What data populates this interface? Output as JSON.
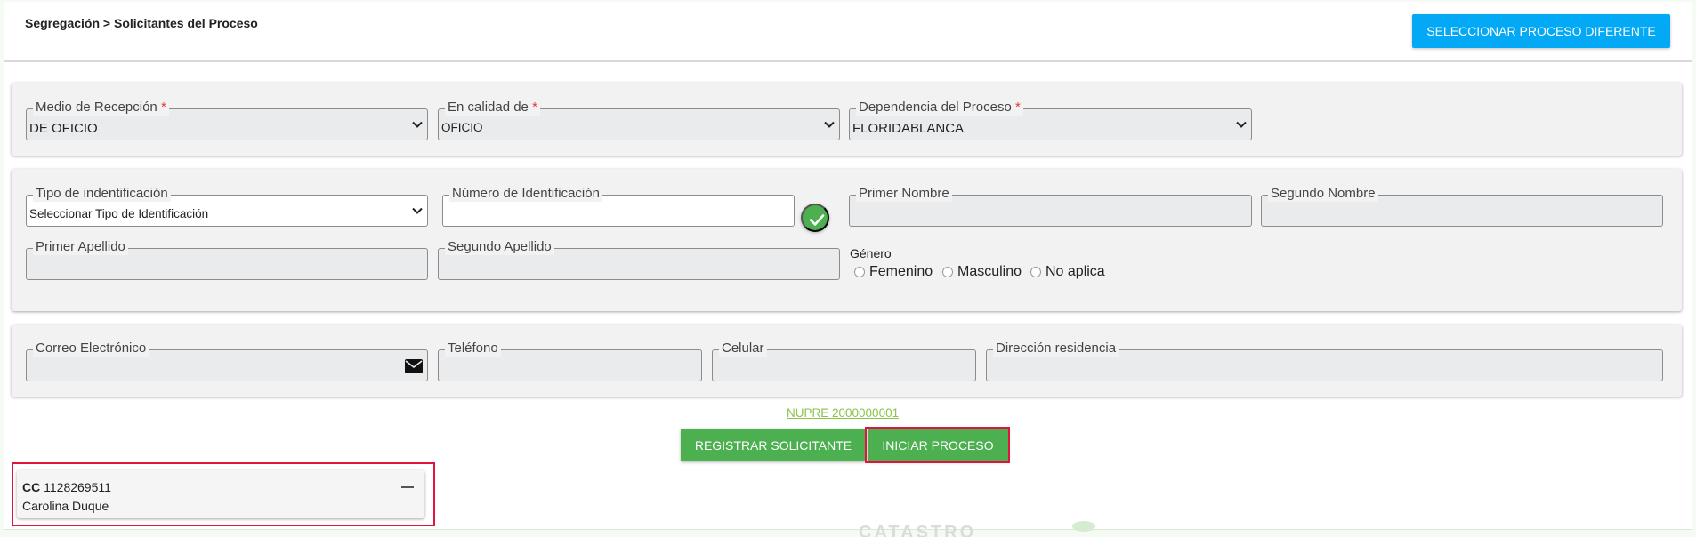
{
  "header": {
    "breadcrumb": "Segregación > Solicitantes del Proceso",
    "select_process_button": "SELECCIONAR PROCESO DIFERENTE"
  },
  "reception": {
    "medio": {
      "label": "Medio de Recepción",
      "value": "DE OFICIO"
    },
    "calidad": {
      "label": "En calidad de",
      "value": "OFICIO"
    },
    "dependencia": {
      "label": "Dependencia del Proceso",
      "value": "FLORIDABLANCA"
    }
  },
  "identity": {
    "tipo_id": {
      "label": "Tipo de indentificación",
      "value": "Seleccionar Tipo de Identificación"
    },
    "numero_id": {
      "label": "Número de Identificación",
      "value": ""
    },
    "primer_nombre": {
      "label": "Primer Nombre",
      "value": ""
    },
    "segundo_nombre": {
      "label": "Segundo Nombre",
      "value": ""
    },
    "primer_apellido": {
      "label": "Primer Apellido",
      "value": ""
    },
    "segundo_apellido": {
      "label": "Segundo Apellido",
      "value": ""
    },
    "genero": {
      "label": "Género",
      "options": [
        "Femenino",
        "Masculino",
        "No aplica"
      ]
    }
  },
  "contact": {
    "correo": {
      "label": "Correo Electrónico",
      "value": ""
    },
    "telefono": {
      "label": "Teléfono",
      "value": ""
    },
    "celular": {
      "label": "Celular",
      "value": ""
    },
    "direccion": {
      "label": "Dirección residencia",
      "value": ""
    }
  },
  "actions": {
    "nupre": "NUPRE 2000000001",
    "register_button": "REGISTRAR SOLICITANTE",
    "start_button": "INICIAR PROCESO"
  },
  "applicants": [
    {
      "id_type": "CC",
      "id_number": "1128269511",
      "name": "Carolina Duque"
    }
  ],
  "watermark": "CATASTRO",
  "colors": {
    "accent_blue": "#03a9f4",
    "accent_green": "#4caf50",
    "highlight_red": "#e0143c",
    "link_green": "#8bc34a"
  }
}
